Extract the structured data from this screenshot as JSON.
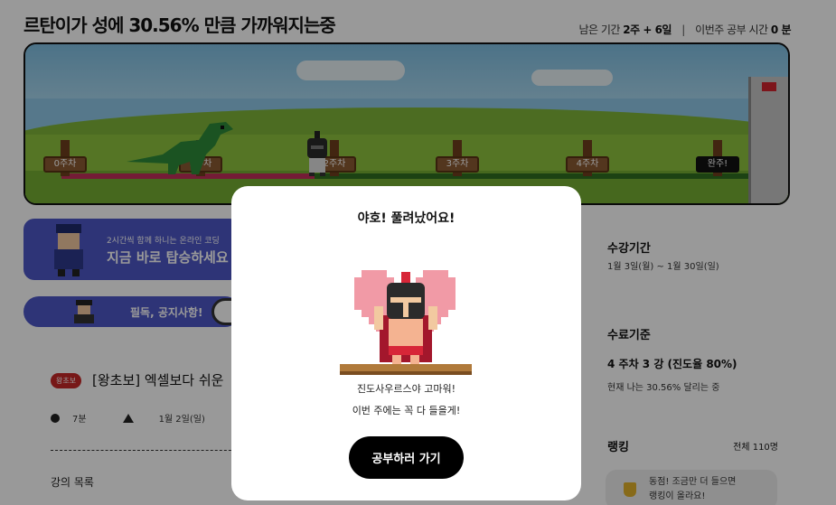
{
  "header": {
    "title": "르탄이가 성에 30.56% 만큼 가까워지는중",
    "remaining_label": "남은 기간",
    "remaining_value": "2주 + 6일",
    "separator": "|",
    "week_study_label": "이번주 공부 시간",
    "week_study_value": "0 분"
  },
  "map": {
    "milestones": [
      "0주차",
      "1주차",
      "2주차",
      "3주차",
      "4주차",
      "완주!"
    ],
    "progress_percent": 30.56
  },
  "banner": {
    "subtitle": "2시간씩 함께 하니는 온라인 코딩",
    "title": "지금 바로 탑승하세요"
  },
  "notice": {
    "label": "필독, 공지사항!"
  },
  "course": {
    "badge": "왕초보",
    "title": "[왕초보] 엑셀보다 쉬운",
    "duration": "7분",
    "date": "1월 2일(일)",
    "list_label": "강의 목록"
  },
  "sidebar": {
    "period": {
      "heading": "수강기간",
      "text": "1월 3일(월) ~ 1월 30일(일)"
    },
    "completion": {
      "heading": "수료기준",
      "value": "4 주차 3 강 (진도율 80%)",
      "text": "현재 나는 30.56% 달리는 중"
    },
    "ranking": {
      "heading": "랭킹",
      "total": "전체 110명",
      "msg_line1": "동점! 조금만 더 들으면",
      "msg_line2": "랭킹이 올라요!"
    }
  },
  "modal": {
    "title": "야호! 풀려났어요!",
    "message_line1": "진도사우르스야 고마워!",
    "message_line2": "이번 주에는 꼭 다 들을게!",
    "button_label": "공부하러 가기"
  },
  "colors": {
    "accent": "#4e57c7",
    "progress": "#c2305a",
    "badge": "#c62828",
    "button": "#000000"
  }
}
